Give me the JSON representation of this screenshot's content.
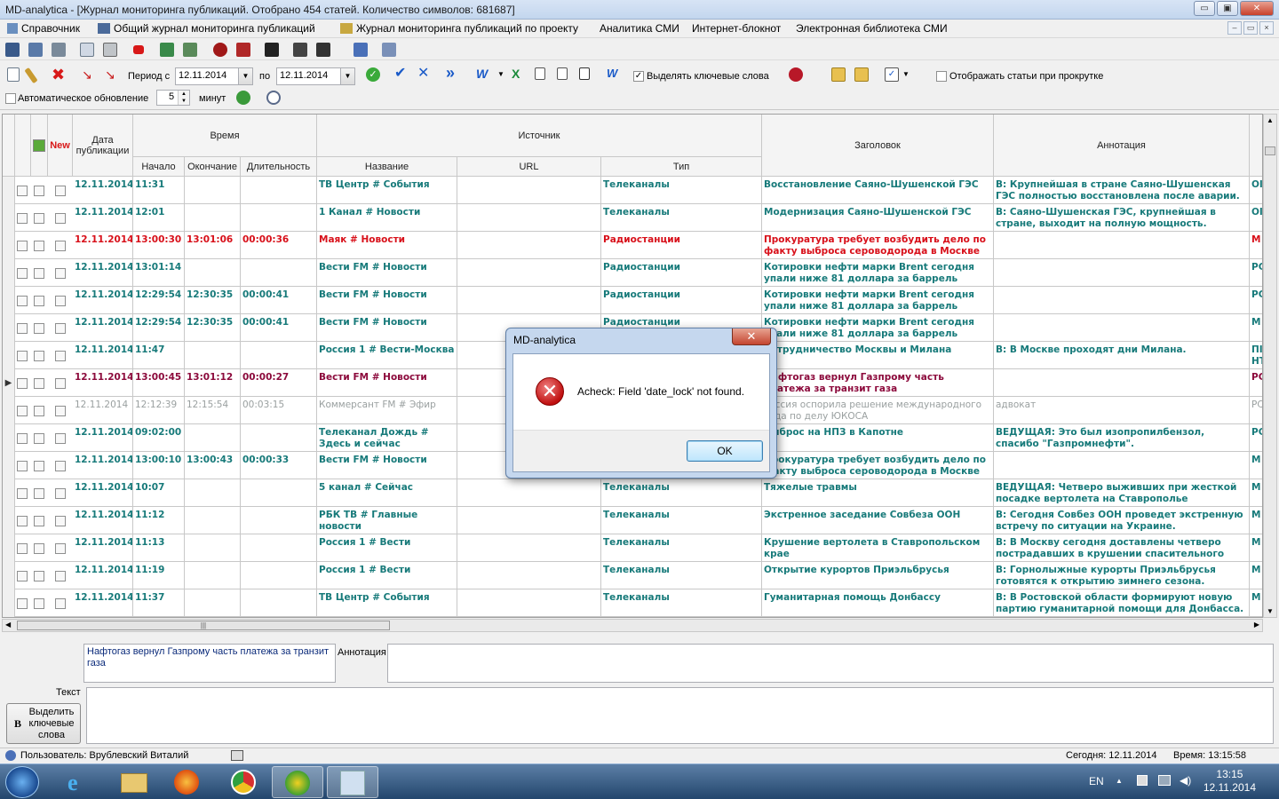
{
  "window": {
    "title": "MD-analytica   - [Журнал мониторинга публикаций. Отобрано 454 статей. Количество символов: 681687]",
    "minimize": "▭",
    "maximize": "▣",
    "close": "✕"
  },
  "menu": {
    "items": [
      "Справочник",
      "Общий журнал мониторинга публикаций",
      "Журнал мониторинга публикаций по проекту",
      "Аналитика СМИ",
      "Интернет-блокнот",
      "Электронная библиотека СМИ"
    ]
  },
  "filter": {
    "period_from_label": "Период с",
    "period_from": "12.11.2014",
    "period_to_label": "по",
    "period_to": "12.11.2014",
    "highlight_keywords_label": "Выделять ключевые слова",
    "highlight_keywords_checked": true,
    "show_on_scroll_label": "Отображать статьи при прокрутке",
    "show_on_scroll_checked": false,
    "auto_update_label": "Автоматическое обновление",
    "auto_update_checked": false,
    "minutes_value": "5",
    "minutes_label": "минут"
  },
  "grid": {
    "headers": {
      "new": "New",
      "pub_date": "Дата публикации",
      "time_group": "Время",
      "start": "Начало",
      "end": "Окончание",
      "duration": "Длительность",
      "source_group": "Источник",
      "name": "Название",
      "url": "URL",
      "type": "Тип",
      "headline": "Заголовок",
      "annotation": "Аннотация"
    },
    "rows": [
      {
        "style": "ok",
        "date": "12.11.2014",
        "start": "11:31",
        "end": "",
        "duration": "",
        "name": "ТВ Центр # События",
        "url": "",
        "type": "Телеканалы",
        "headline": "Восстановление Саяно-Шушенской ГЭС",
        "annotation": "В: Крупнейшая в стране Саяно-Шушенская ГЭС полностью восстановлена после аварии.",
        "extra": "ОІ"
      },
      {
        "style": "ok",
        "date": "12.11.2014",
        "start": "12:01",
        "end": "",
        "duration": "",
        "name": "1 Канал # Новости",
        "url": "",
        "type": "Телеканалы",
        "headline": "Модернизация Саяно-Шушенской ГЭС",
        "annotation": "В: Саяно-Шушенская ГЭС, крупнейшая в стране, выходит на полную мощность.",
        "extra": "ОІ"
      },
      {
        "style": "red",
        "date": "12.11.2014",
        "start": "13:00:30",
        "end": "13:01:06",
        "duration": "00:00:36",
        "name": "Маяк # Новости",
        "url": "",
        "type": "Радиостанции",
        "headline": "Прокуратура требует возбудить дело по факту выброса сероводорода в Москве",
        "annotation": "",
        "extra": "М"
      },
      {
        "style": "ok",
        "date": "12.11.2014",
        "start": "13:01:14",
        "end": "",
        "duration": "",
        "name": "Вести FM # Новости",
        "url": "",
        "type": "Радиостанции",
        "headline": "Котировки нефти марки Brent сегодня упали ниже 81 доллара за баррель",
        "annotation": "",
        "extra": "РС"
      },
      {
        "style": "ok",
        "date": "12.11.2014",
        "start": "12:29:54",
        "end": "12:30:35",
        "duration": "00:00:41",
        "name": "Вести FM # Новости",
        "url": "",
        "type": "Радиостанции",
        "headline": "Котировки нефти марки Brent сегодня упали ниже 81 доллара за баррель",
        "annotation": "",
        "extra": "РС"
      },
      {
        "style": "ok",
        "date": "12.11.2014",
        "start": "12:29:54",
        "end": "12:30:35",
        "duration": "00:00:41",
        "name": "Вести FM # Новости",
        "url": "",
        "type": "Радиостанции",
        "headline": "Котировки нефти марки Brent сегодня упали ниже 81 доллара за баррель",
        "annotation": "",
        "extra": "М"
      },
      {
        "style": "ok",
        "date": "12.11.2014",
        "start": "11:47",
        "end": "",
        "duration": "",
        "name": "Россия 1 # Вести-Москва",
        "url": "",
        "type": "Телеканалы",
        "headline": "Сотрудничество Москвы и Милана",
        "annotation": "В: В Москве проходят дни Милана.",
        "extra": "ПІ НТ"
      },
      {
        "style": "maroon",
        "date": "12.11.2014",
        "start": "13:00:45",
        "end": "13:01:12",
        "duration": "00:00:27",
        "name": "Вести FM # Новости",
        "url": "",
        "type": "Радиостанции",
        "headline": "Нафтогаз вернул Газпрому часть платежа за транзит газа",
        "annotation": "",
        "extra": "РС",
        "current": true
      },
      {
        "style": "muted",
        "date": "12.11.2014",
        "start": "12:12:39",
        "end": "12:15:54",
        "duration": "00:03:15",
        "name": "Коммерсант FM # Эфир",
        "url": "",
        "type": "Радиостанции",
        "headline": "Россия оспорила решение международного суда по делу ЮКОСА",
        "annotation": "адвокат",
        "extra": "РС"
      },
      {
        "style": "ok",
        "date": "12.11.2014",
        "start": "09:02:00",
        "end": "",
        "duration": "",
        "name": "Телеканал Дождь # Здесь и сейчас",
        "url": "",
        "type": "Телеканалы",
        "headline": "Выброс на НПЗ в Капотне",
        "annotation": "ВЕДУЩАЯ: Это был изопропилбензол, спасибо \"Газпромнефти\".",
        "extra": "РС"
      },
      {
        "style": "ok",
        "date": "12.11.2014",
        "start": "13:00:10",
        "end": "13:00:43",
        "duration": "00:00:33",
        "name": "Вести FM # Новости",
        "url": "",
        "type": "Радиостанции",
        "headline": "Прокуратура требует возбудить дело по факту выброса сероводорода в Москве",
        "annotation": "",
        "extra": "М"
      },
      {
        "style": "ok",
        "date": "12.11.2014",
        "start": "10:07",
        "end": "",
        "duration": "",
        "name": "5 канал # Сейчас",
        "url": "",
        "type": "Телеканалы",
        "headline": "Тяжелые травмы",
        "annotation": "ВЕДУЩАЯ: Четверо выживших при жесткой посадке вертолета на Ставрополье",
        "extra": "М"
      },
      {
        "style": "ok",
        "date": "12.11.2014",
        "start": "11:12",
        "end": "",
        "duration": "",
        "name": "РБК ТВ # Главные новости",
        "url": "",
        "type": "Телеканалы",
        "headline": "Экстренное заседание Совбеза ООН",
        "annotation": "В: Сегодня Совбез ООН проведет экстренную встречу по ситуации на Украине.",
        "extra": "М"
      },
      {
        "style": "ok",
        "date": "12.11.2014",
        "start": "11:13",
        "end": "",
        "duration": "",
        "name": "Россия 1 # Вести",
        "url": "",
        "type": "Телеканалы",
        "headline": "Крушение вертолета в Ставропольском крае",
        "annotation": "В: В Москву сегодня доставлены четверо пострадавших в крушении спасительного",
        "extra": "М"
      },
      {
        "style": "ok",
        "date": "12.11.2014",
        "start": "11:19",
        "end": "",
        "duration": "",
        "name": "Россия 1 # Вести",
        "url": "",
        "type": "Телеканалы",
        "headline": "Открытие курортов Приэльбрусья",
        "annotation": "В: Горнолыжные курорты Приэльбрусья готовятся к открытию зимнего сезона.",
        "extra": "М"
      },
      {
        "style": "ok",
        "date": "12.11.2014",
        "start": "11:37",
        "end": "",
        "duration": "",
        "name": "ТВ Центр # События",
        "url": "",
        "type": "Телеканалы",
        "headline": "Гуманитарная помощь Донбассу",
        "annotation": "В: В Ростовской области формируют новую партию гуманитарной помощи для Донбасса.",
        "extra": "М"
      }
    ]
  },
  "details": {
    "headline_text": "Нафтогаз вернул Газпрому часть платежа за транзит газа",
    "annotation_label": "Аннотация",
    "text_label": "Текст",
    "highlight_button": "Выделить ключевые слова",
    "highlight_button_glyph": "B"
  },
  "status": {
    "user": "Пользователь: Врублевский Виталий",
    "today": "Сегодня: 12.11.2014",
    "time": "Время: 13:15:58"
  },
  "dialog": {
    "title": "MD-analytica",
    "message": "Acheck: Field 'date_lock' not found.",
    "ok": "OK",
    "close": "✕"
  },
  "taskbar": {
    "lang": "EN",
    "clock_time": "13:15",
    "clock_date": "12.11.2014"
  },
  "colors": {
    "row_ok": "#177a7a",
    "row_red": "#d8101a",
    "row_maroon": "#8c0a3c",
    "row_muted": "#9aa0a0"
  }
}
